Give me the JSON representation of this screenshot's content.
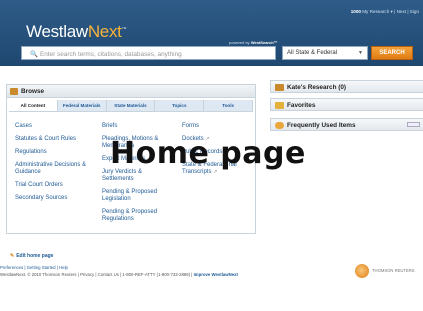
{
  "header": {
    "account_number": "1000",
    "account_links": "My Research  ▾  |  Next  |  Sign",
    "logo_primary": "Westlaw",
    "logo_secondary": "Next",
    "powered_by_prefix": "powered by",
    "powered_by_brand": "WestSearch™",
    "search_placeholder": "Enter search terms, citations, databases, anything",
    "jurisdiction": "All State & Federal",
    "search_button": "SEARCH"
  },
  "browse": {
    "title": "Browse",
    "tabs": [
      "All Content",
      "Federal Materials",
      "State Materials",
      "Topics",
      "Tools"
    ],
    "columns": [
      [
        "Cases",
        "Statutes & Court Rules",
        "Regulations",
        "Administrative Decisions & Guidance",
        "Trial Court Orders",
        "Secondary Sources"
      ],
      [
        "Briefs",
        "Pleadings, Motions & Memoranda",
        "Expert Materials",
        "Jury Verdicts & Settlements",
        "Pending & Proposed Legislation",
        "Pending & Proposed Regulations"
      ],
      [
        "Forms",
        "Dockets",
        "",
        "Public Records",
        "State & Federal Trial Transcripts"
      ]
    ]
  },
  "right_panels": {
    "research": "Kate's Research (0)",
    "favorites": "Favorites",
    "frequently_used": "Frequently Used Items"
  },
  "footer": {
    "edit_home": "Edit home page",
    "links": "Preferences | Getting Started | Help",
    "copyright": "WestlawNext. © 2010 Thomson Reuters | Privacy | Contact Us | 1-800-REF-ATTY (1-800-733-2889) |",
    "improve": "Improve WestlawNext",
    "thomson_reuters": "THOMSON REUTERS"
  },
  "overlay": {
    "label": "Home page"
  },
  "colors": {
    "header_bg": "#2e5c88",
    "accent_orange": "#e07c14",
    "link_blue": "#1f5a96"
  }
}
